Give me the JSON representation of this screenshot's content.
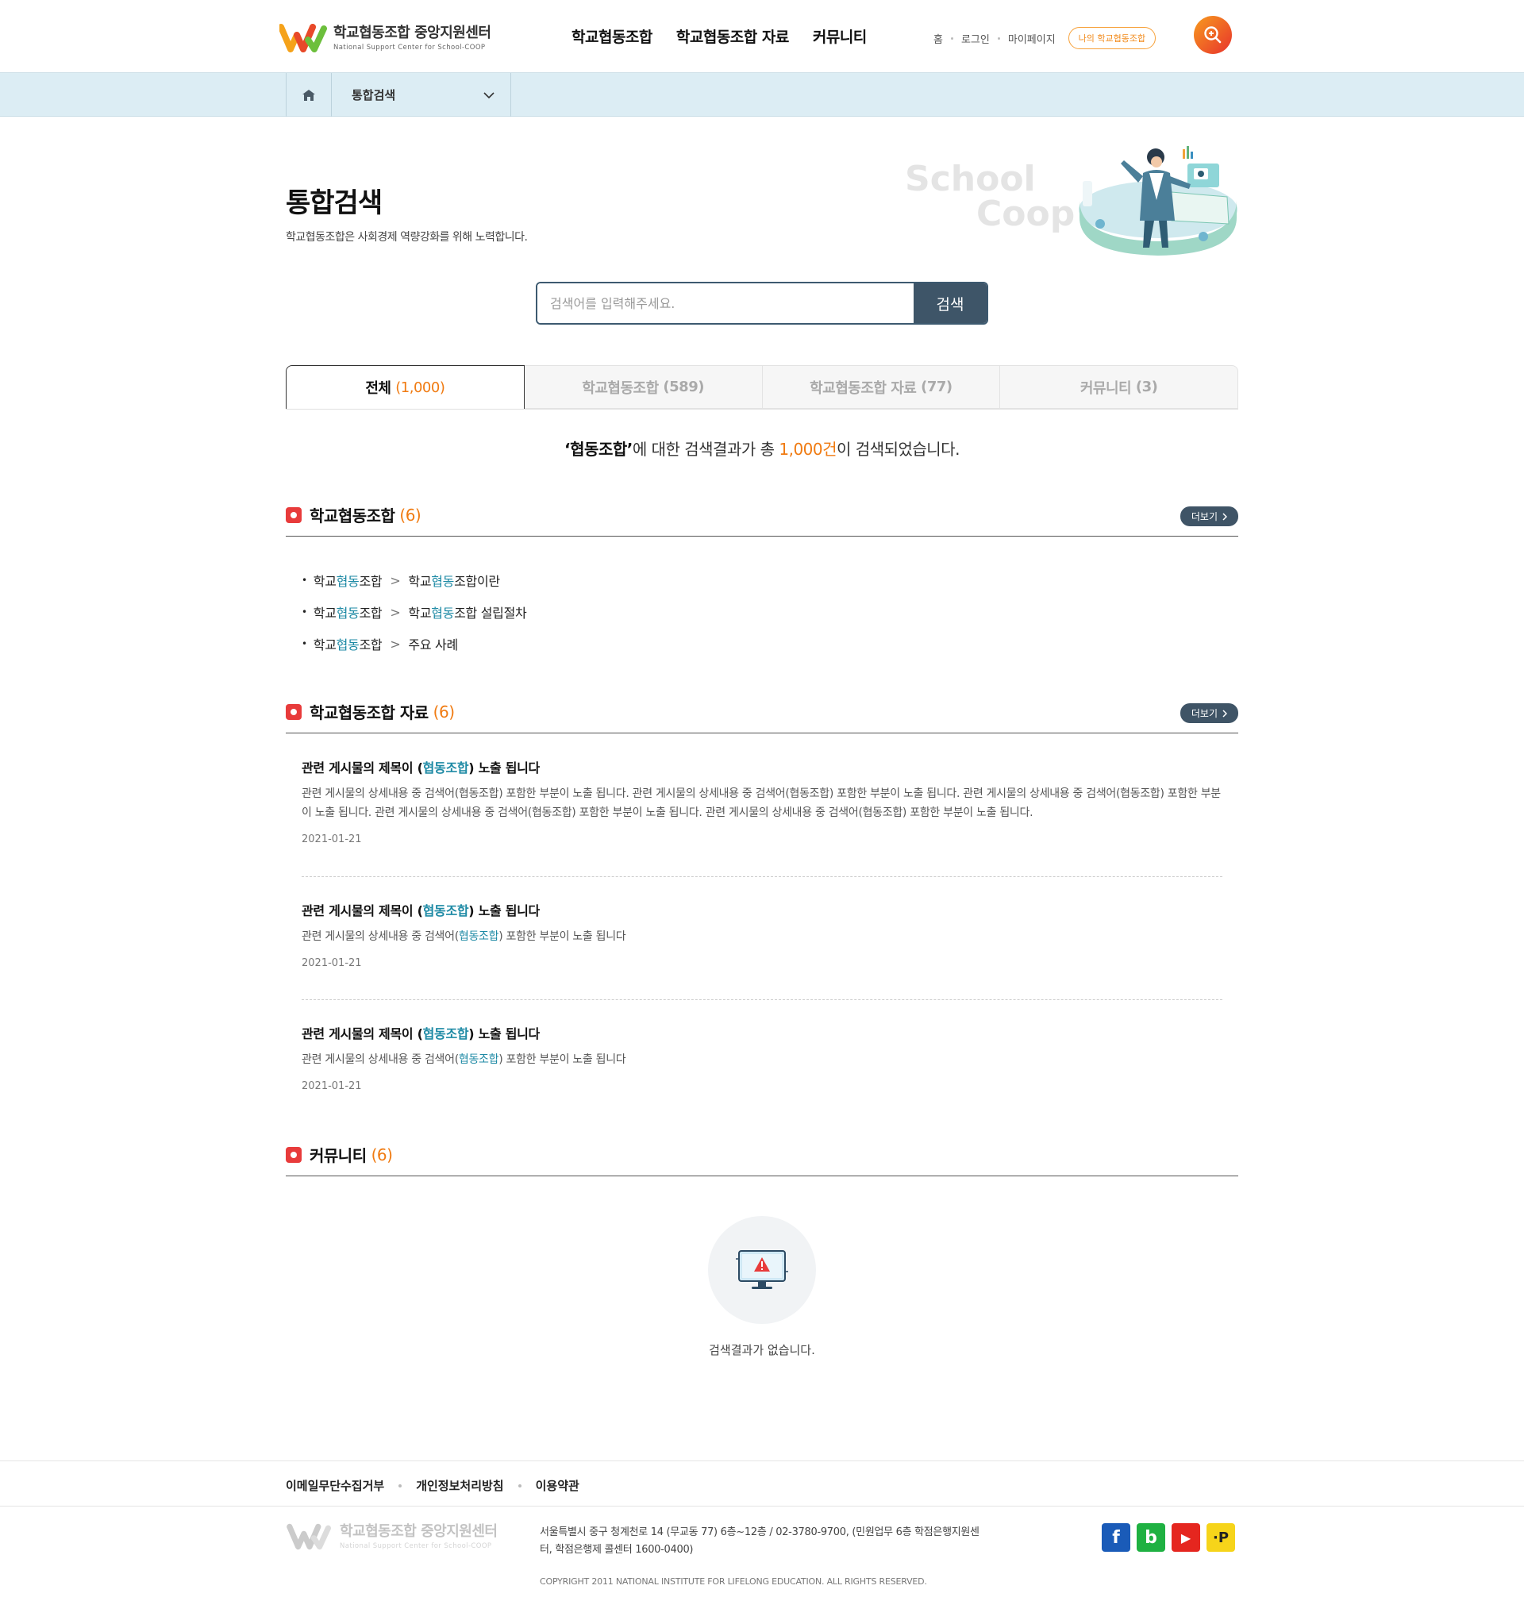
{
  "header": {
    "logo_title": "학교협동조합 중앙지원센터",
    "logo_sub": "National Support Center for School-COOP",
    "nav": [
      "학교협동조합",
      "학교협동조합 자료",
      "커뮤니티"
    ],
    "util": [
      "홈",
      "로그인",
      "마이페이지"
    ],
    "my_coop_button": "나의 학교협동조합",
    "search_icon": "search-icon"
  },
  "location": {
    "home_icon": "home-icon",
    "current": "통합검색"
  },
  "page": {
    "title": "통합검색",
    "description": "학교협동조합은 사회경제 역량강화를 위해 노력합니다.",
    "hero_line1": "School",
    "hero_line2": "Coop"
  },
  "search": {
    "placeholder": "검색어를 입력해주세요.",
    "button": "검색"
  },
  "tabs": [
    {
      "label": "전체",
      "count": "(1,000)"
    },
    {
      "label": "학교협동조합",
      "count": "(589)"
    },
    {
      "label": "학교협동조합 자료",
      "count": "(77)"
    },
    {
      "label": "커뮤니티",
      "count": "(3)"
    }
  ],
  "summary": {
    "keyword": "‘협동조합’",
    "middle": "에 대한 검색결과가 총 ",
    "count": "1,000건",
    "tail": "이 검색되었습니다."
  },
  "sections": {
    "coop": {
      "title": "학교협동조합",
      "count": "(6)",
      "more": "더보기",
      "links": [
        {
          "path_a": "학교",
          "path_kw": "협동",
          "path_b": "조합",
          "sep": ">",
          "tgt_a": "학교",
          "tgt_kw": "협동",
          "tgt_b": "조합이란"
        },
        {
          "path_a": "학교",
          "path_kw": "협동",
          "path_b": "조합",
          "sep": ">",
          "tgt_a": "학교",
          "tgt_kw": "협동",
          "tgt_b": "조합 설립절차"
        },
        {
          "path_a": "학교",
          "path_kw": "협동",
          "path_b": "조합",
          "sep": ">",
          "tgt_a": "",
          "tgt_kw": "",
          "tgt_b": "주요 사례"
        }
      ]
    },
    "materials": {
      "title": "학교협동조합 자료",
      "count": "(6)",
      "more": "더보기",
      "posts": [
        {
          "title_a": "관련 게시물의 제목이 (",
          "title_kw": "협동조합",
          "title_b": ") 노출 됩니다",
          "body_a": "관련 게시물의 상세내용 중 검색어(협동조합) 포함한 부분이 노출 됩니다. 관련 게시물의 상세내용 중 검색어(협동조합) 포함한 부분이 노출 됩니다. 관련 게시물의 상세내용 중 검색어(협동조합) 포함한 부분이 노출 됩니다. 관련 게시물의 상세내용 중 검색어(협동조합) 포함한 부분이 노출 됩니다. 관련 게시물의 상세내용 중 검색어(협동조합) 포함한 부분이 노출 됩니다.",
          "body_kw": "",
          "body_b": "",
          "date": "2021-01-21"
        },
        {
          "title_a": "관련 게시물의 제목이 (",
          "title_kw": "협동조합",
          "title_b": ") 노출 됩니다",
          "body_a": "관련 게시물의 상세내용 중 검색어(",
          "body_kw": "협동조합",
          "body_b": ") 포함한 부분이 노출 됩니다",
          "date": "2021-01-21"
        },
        {
          "title_a": "관련 게시물의 제목이 (",
          "title_kw": "협동조합",
          "title_b": ") 노출 됩니다",
          "body_a": "관련 게시물의 상세내용 중 검색어(",
          "body_kw": "협동조합",
          "body_b": ") 포함한 부분이 노출 됩니다",
          "date": "2021-01-21"
        }
      ]
    },
    "community": {
      "title": "커뮤니티",
      "count": "(6)",
      "empty_icon": "warning-monitor-icon",
      "empty_text": "검색결과가 없습니다."
    }
  },
  "footer": {
    "links": [
      "이메일무단수집거부",
      "개인정보처리방침",
      "이용약관"
    ],
    "logo_title": "학교협동조합 중앙지원센터",
    "logo_sub": "National Support Center for School-COOP",
    "address": "서울특별시 중구 청계천로 14 (무교동 77) 6층~12층 / 02-3780-9700, (민원업무 6층 학점은행지원센터, 학점은행제 콜센터 1600-0400)",
    "copyright": "COPYRIGHT 2011 NATIONAL INSTITUTE FOR LIFELONG EDUCATION. ALL RIGHTS RESERVED.",
    "sns": [
      {
        "icon": "facebook-icon",
        "glyph": "f",
        "color": "#1a5bb8"
      },
      {
        "icon": "blog-icon",
        "glyph": "b",
        "color": "#1fb142"
      },
      {
        "icon": "youtube-icon",
        "glyph": "▶",
        "color": "#e5261f"
      },
      {
        "icon": "post-icon",
        "glyph": "·P",
        "color": "#f6d41a"
      }
    ]
  },
  "colors": {
    "accent": "#f07b12",
    "keyword": "#1e8aa5",
    "button": "#3e5568",
    "section_icon": "#e83b3b"
  }
}
